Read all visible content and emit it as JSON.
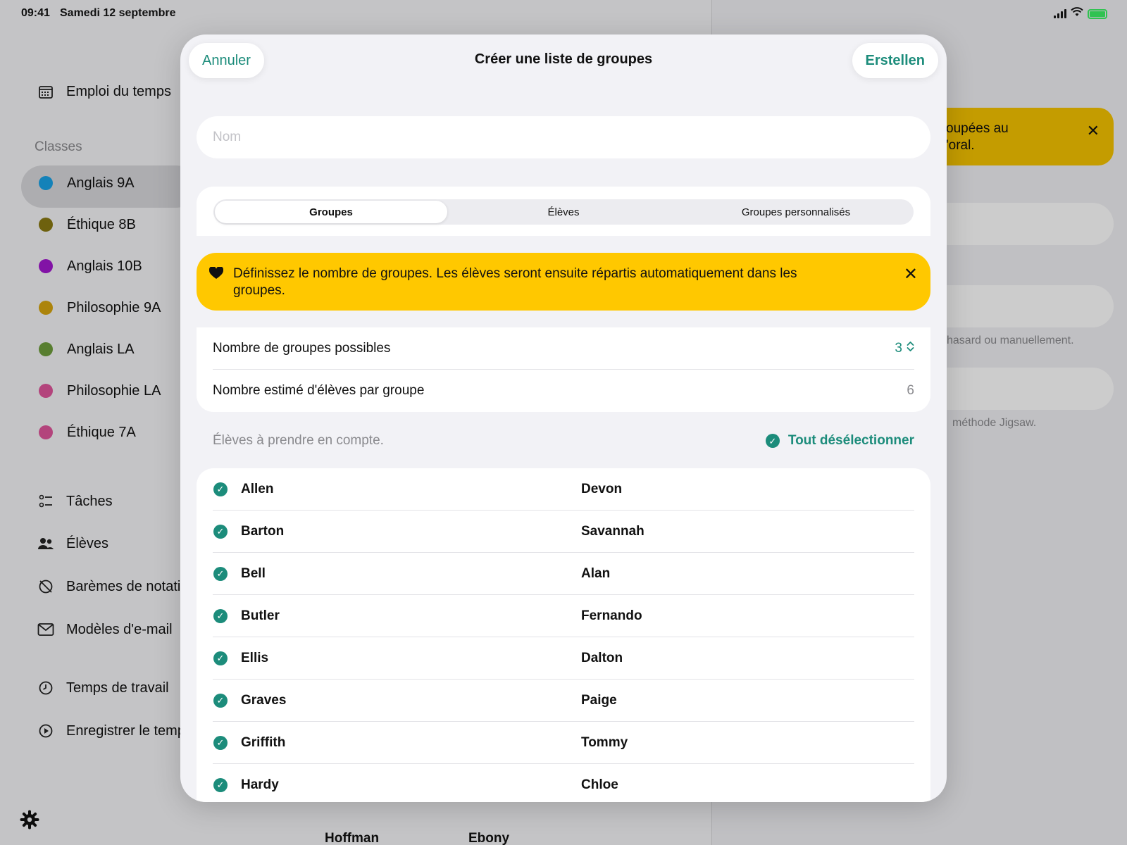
{
  "status": {
    "time": "09:41",
    "date": "Samedi 12 septembre"
  },
  "sidebar": {
    "schedule_label": "Emploi du temps",
    "classes_header": "Classes",
    "classes": [
      {
        "name": "Anglais 9A",
        "color": "#1aa3e8"
      },
      {
        "name": "Éthique 8B",
        "color": "#8a7a12"
      },
      {
        "name": "Anglais 10B",
        "color": "#a318d0"
      },
      {
        "name": "Philosophie 9A",
        "color": "#d8a60e"
      },
      {
        "name": "Anglais LA",
        "color": "#6f9e3c"
      },
      {
        "name": "Philosophie LA",
        "color": "#e0559b"
      },
      {
        "name": "Éthique 7A",
        "color": "#e0559b"
      }
    ],
    "tools": [
      {
        "label": "Tâches",
        "icon": "tasks-icon"
      },
      {
        "label": "Élèves",
        "icon": "students-icon"
      },
      {
        "label": "Barèmes de notati",
        "icon": "grading-icon"
      },
      {
        "label": "Modèles d'e-mail",
        "icon": "mail-icon"
      }
    ],
    "time": [
      {
        "label": "Temps de travail",
        "icon": "clock-icon"
      },
      {
        "label": "Enregistrer le temp",
        "icon": "record-icon"
      }
    ]
  },
  "background_detail": {
    "banner_text": "oupées au\n'oral.",
    "hint1": "hasard ou manuellement.",
    "hint2": "méthode Jigsaw.",
    "peek_last": "Hoffman",
    "peek_first": "Ebony"
  },
  "modal": {
    "cancel_label": "Annuler",
    "title": "Créer une liste de groupes",
    "create_label": "Erstellen",
    "name_placeholder": "Nom",
    "tabs": [
      "Groupes",
      "Élèves",
      "Groupes personnalisés"
    ],
    "active_tab": 0,
    "info_text": "Définissez le nombre de groupes. Les élèves seront ensuite répartis automatiquement dans les groupes.",
    "settings": {
      "groups_label": "Nombre de groupes possibles",
      "groups_value": "3",
      "estimate_label": "Nombre estimé d'élèves par groupe",
      "estimate_value": "6"
    },
    "students_header": "Élèves à prendre en compte.",
    "deselect_all": "Tout désélectionner",
    "students": [
      {
        "last": "Allen",
        "first": "Devon",
        "checked": true
      },
      {
        "last": "Barton",
        "first": "Savannah",
        "checked": true
      },
      {
        "last": "Bell",
        "first": "Alan",
        "checked": true
      },
      {
        "last": "Butler",
        "first": "Fernando",
        "checked": true
      },
      {
        "last": "Ellis",
        "first": "Dalton",
        "checked": true
      },
      {
        "last": "Graves",
        "first": "Paige",
        "checked": true
      },
      {
        "last": "Griffith",
        "first": "Tommy",
        "checked": true
      },
      {
        "last": "Hardy",
        "first": "Chloe",
        "checked": true
      }
    ]
  },
  "colors": {
    "accent": "#1c8c7b",
    "banner": "#ffc800"
  }
}
